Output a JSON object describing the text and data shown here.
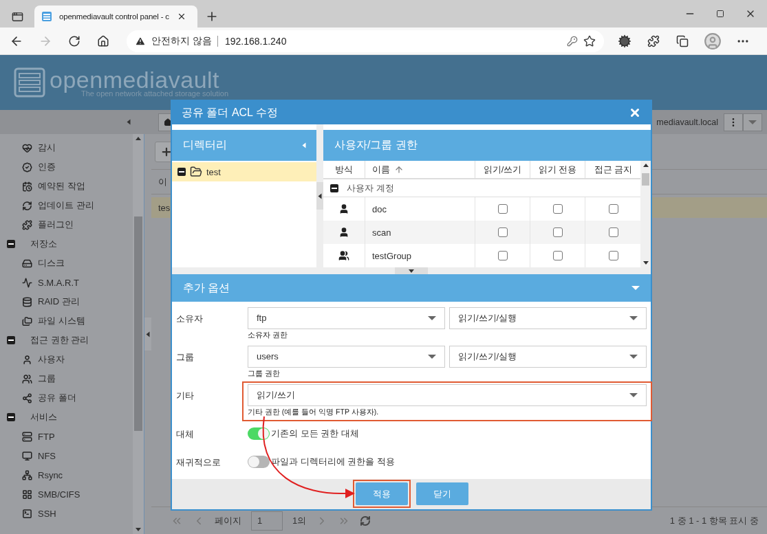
{
  "browser": {
    "tab_title": "openmediavault control panel - c",
    "security": "안전하지 않음",
    "url": "192.168.1.240"
  },
  "header": {
    "logo": "openmediavault",
    "tagline": "The open network attached storage solution"
  },
  "toolbar": {
    "host": "mediavault.local"
  },
  "sidebar": {
    "items": [
      {
        "label": "감시"
      },
      {
        "label": "인증"
      },
      {
        "label": "예약된 작업"
      },
      {
        "label": "업데이트 관리"
      },
      {
        "label": "플러그인"
      },
      {
        "label": "저장소",
        "expanded": true,
        "children": [
          {
            "label": "디스크"
          },
          {
            "label": "S.M.A.R.T"
          },
          {
            "label": "RAID 관리"
          },
          {
            "label": "파일 시스템"
          }
        ]
      },
      {
        "label": "접근 권한 관리",
        "expanded": true,
        "children": [
          {
            "label": "사용자"
          },
          {
            "label": "그룹"
          },
          {
            "label": "공유 폴더"
          }
        ]
      },
      {
        "label": "서비스",
        "expanded": true,
        "children": [
          {
            "label": "FTP"
          },
          {
            "label": "NFS"
          },
          {
            "label": "Rsync"
          },
          {
            "label": "SMB/CIFS"
          },
          {
            "label": "SSH"
          }
        ]
      }
    ]
  },
  "grid": {
    "columns": [
      "이"
    ],
    "rows": [
      {
        "cells": [
          "tes"
        ],
        "selected": true
      }
    ]
  },
  "pagination": {
    "page_label": "페이지",
    "page": "1",
    "of": "1의",
    "summary": "1 중 1 - 1 항목 표시 중"
  },
  "dialog": {
    "title": "공유 폴더 ACL 수정",
    "directory_panel": {
      "title": "디렉터리",
      "tree": [
        {
          "label": "test",
          "expanded": true,
          "selected": true
        }
      ]
    },
    "permissions_panel": {
      "title": "사용자/그룹 권한",
      "columns": [
        {
          "label": "방식",
          "sorted": false
        },
        {
          "label": "이름",
          "sorted": true
        },
        {
          "label": "읽기/쓰기",
          "sorted": false
        },
        {
          "label": "읽기 전용",
          "sorted": false
        },
        {
          "label": "접근 금지",
          "sorted": false
        }
      ],
      "groups": [
        {
          "label": "사용자 계정",
          "expanded": true,
          "rows": [
            {
              "kind": "user",
              "name": "doc",
              "read_write": false,
              "read_only": false,
              "no_access": false
            },
            {
              "kind": "user",
              "name": "scan",
              "read_write": false,
              "read_only": false,
              "no_access": false
            },
            {
              "kind": "group",
              "name": "testGroup",
              "read_write": false,
              "read_only": false,
              "no_access": false
            }
          ]
        }
      ]
    },
    "options": {
      "title": "추가 옵션",
      "expanded": true,
      "fields": [
        {
          "kind": "select_pair",
          "label": "소유자",
          "value": "ftp",
          "permission": "읽기/쓰기/실행",
          "hint": "소유자 권한",
          "highlighted": false
        },
        {
          "kind": "select_pair",
          "label": "그룹",
          "value": "users",
          "permission": "읽기/쓰기/실행",
          "hint": "그룹 권한",
          "highlighted": false
        },
        {
          "kind": "select",
          "label": "기타",
          "value": "읽기/쓰기",
          "hint": "기타 권한 (예를 들어 익명 FTP 사용자).",
          "highlighted": true
        },
        {
          "kind": "switch",
          "label": "대체",
          "on": true,
          "text": "기존의 모든 권한 대체"
        },
        {
          "kind": "switch",
          "label": "재귀적으로",
          "on": false,
          "text": "파일과 디렉터리에 권한을 적용"
        }
      ]
    },
    "buttons": [
      {
        "label": "적용",
        "highlighted": true
      },
      {
        "label": "닫기",
        "highlighted": false
      }
    ]
  }
}
